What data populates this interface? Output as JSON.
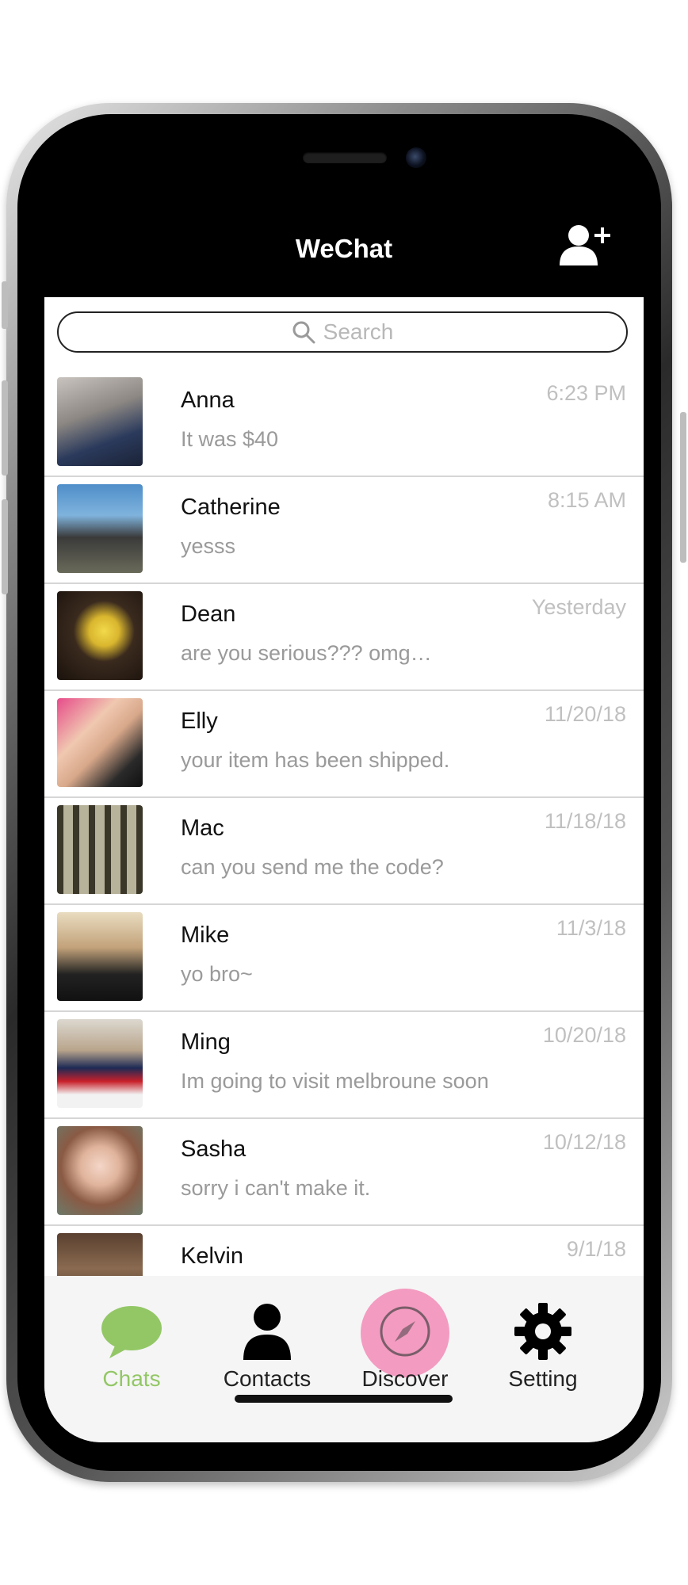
{
  "header": {
    "title": "WeChat",
    "add_icon": "add-contact-icon"
  },
  "search": {
    "placeholder": "Search",
    "icon": "search-icon"
  },
  "chats": [
    {
      "name": "Anna",
      "preview": "It was $40",
      "time": "6:23 PM"
    },
    {
      "name": "Catherine",
      "preview": "yesss",
      "time": "8:15 AM"
    },
    {
      "name": "Dean",
      "preview": "are you serious??? omg…",
      "time": "Yesterday"
    },
    {
      "name": "Elly",
      "preview": "your item has been shipped.",
      "time": "11/20/18"
    },
    {
      "name": "Mac",
      "preview": "can you send me the code?",
      "time": "11/18/18"
    },
    {
      "name": "Mike",
      "preview": "yo bro~",
      "time": "11/3/18"
    },
    {
      "name": "Ming",
      "preview": "Im going to visit melbroune soon",
      "time": "10/20/18"
    },
    {
      "name": "Sasha",
      "preview": "sorry i can't make it.",
      "time": "10/12/18"
    },
    {
      "name": "Kelvin",
      "preview": "",
      "time": "9/1/18"
    }
  ],
  "tabs": [
    {
      "label": "Chats",
      "icon": "chat-bubble-icon",
      "active": true
    },
    {
      "label": "Contacts",
      "icon": "person-icon",
      "active": false
    },
    {
      "label": "Discover",
      "icon": "compass-icon",
      "active": false
    },
    {
      "label": "Setting",
      "icon": "gear-icon",
      "active": false
    }
  ],
  "colors": {
    "accent": "#93c766",
    "highlight": "#f39bc0",
    "header_bg": "#000000"
  }
}
